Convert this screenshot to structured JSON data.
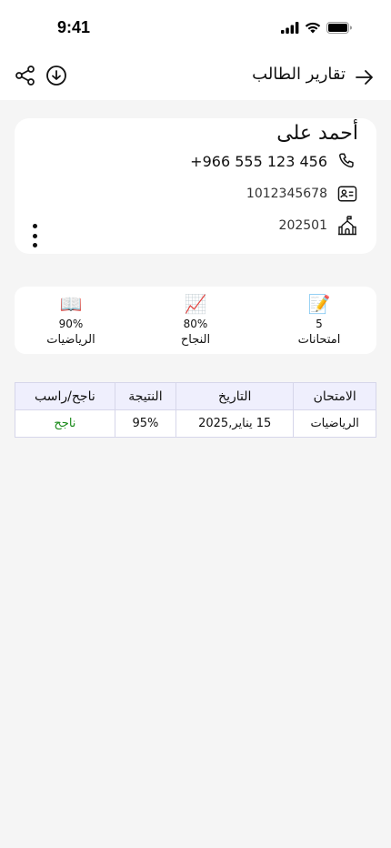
{
  "status_bar": {
    "time": "9:41"
  },
  "header": {
    "title": "تقارير الطالب",
    "back_icon": "arrow-right-icon",
    "download_icon": "download-icon",
    "share_icon": "share-icon"
  },
  "profile": {
    "name": "أحمد على",
    "phone": "+966 555 123 456",
    "national_id": "1012345678",
    "school_code": "202501"
  },
  "stats": [
    {
      "emoji": "📝",
      "value": "5",
      "label": "امتحانات"
    },
    {
      "emoji": "📈",
      "value": "80%",
      "label": "النجاح"
    },
    {
      "emoji": "📖",
      "value": "90%",
      "label": "الرياضيات"
    }
  ],
  "table": {
    "headers": [
      "الامتحان",
      "التاريخ",
      "النتيجة",
      "ناجح/راسب"
    ],
    "rows": [
      {
        "exam": "الرياضيات",
        "date": "15 يناير,2025",
        "result": "95%",
        "status": "ناجح"
      }
    ]
  },
  "colors": {
    "pass": "#1a8a1a",
    "table_header_bg": "#efeffd",
    "card_bg": "#ffffff",
    "page_bg": "#f5f5f5"
  }
}
